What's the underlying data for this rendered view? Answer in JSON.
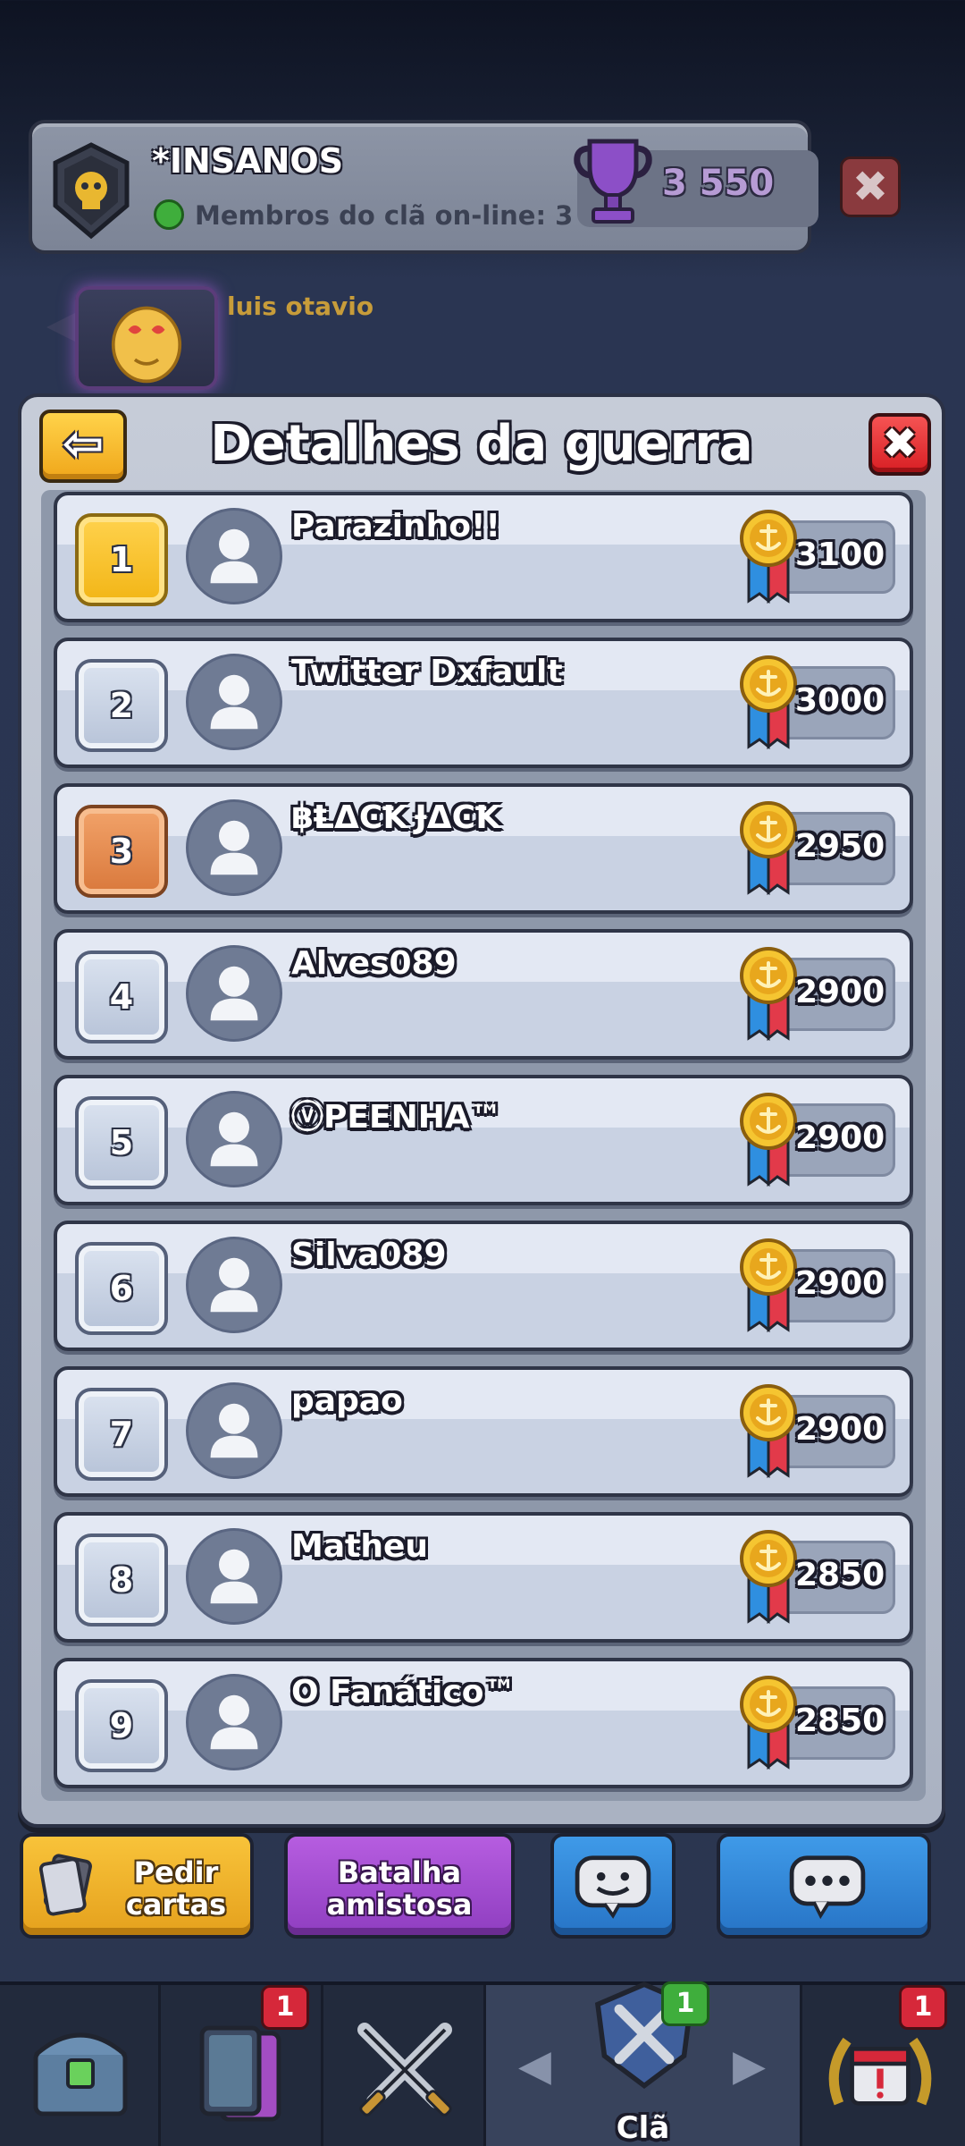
{
  "clan": {
    "name": "*INSANOS",
    "online_text": "Membros do clã on-line: 3",
    "trophies": "3 550",
    "close_label": "✖"
  },
  "chat": {
    "sender_name": "luis otavio"
  },
  "panel": {
    "title": "Detalhes da guerra",
    "back_label": "⇦",
    "close_label": "✖",
    "rows": [
      {
        "rank": "1",
        "name": "Parazinho!!",
        "score": "3100",
        "medal_tier": "gold"
      },
      {
        "rank": "2",
        "name": "Twitter Dxfault",
        "score": "3000",
        "medal_tier": "silver"
      },
      {
        "rank": "3",
        "name": "฿ⱠΔϾꝀ ɈΔϾꝀ",
        "score": "2950",
        "medal_tier": "bronze"
      },
      {
        "rank": "4",
        "name": "Alves089",
        "score": "2900",
        "medal_tier": "none"
      },
      {
        "rank": "5",
        "name": "ⓥPEENHA™",
        "score": "2900",
        "medal_tier": "none"
      },
      {
        "rank": "6",
        "name": "Silva089",
        "score": "2900",
        "medal_tier": "none"
      },
      {
        "rank": "7",
        "name": "papao",
        "score": "2900",
        "medal_tier": "none"
      },
      {
        "rank": "8",
        "name": "Matheu",
        "score": "2850",
        "medal_tier": "none"
      },
      {
        "rank": "9",
        "name": "O Fanático™",
        "score": "2850",
        "medal_tier": "none"
      }
    ]
  },
  "actions": {
    "request_cards": "Pedir cartas",
    "friendly_battle": "Batalha amistosa",
    "emote_icon": "smiley-chat-icon",
    "chat_icon": "speech-bubble-icon"
  },
  "nav": {
    "shop_icon": "chest-icon",
    "cards_icon": "cards-icon",
    "cards_badge": "1",
    "battle_icon": "crossed-swords-icon",
    "clan_label": "Clã",
    "clan_badge": "1",
    "events_icon": "calendar-laurel-icon",
    "events_badge": "1"
  },
  "colors": {
    "gold": "#f2b516",
    "bronze": "#d9783b",
    "accent_red": "#d81f24",
    "online_green": "#3fae3c"
  }
}
